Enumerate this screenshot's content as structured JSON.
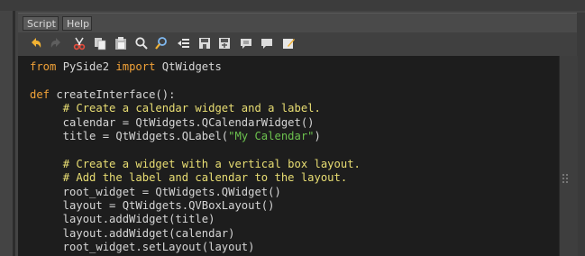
{
  "menu": {
    "items": [
      {
        "label": "Script"
      },
      {
        "label": "Help"
      }
    ]
  },
  "toolbar": {
    "icons": [
      "undo-icon",
      "redo-icon",
      "cut-icon",
      "copy-icon",
      "paste-icon",
      "find-icon",
      "replace-icon",
      "indent-icon",
      "save-icon",
      "save-as-icon",
      "comment-icon",
      "uncomment-icon",
      "edit-icon"
    ]
  },
  "editor": {
    "lines": [
      [
        {
          "t": "kw",
          "v": "from"
        },
        {
          "t": "tx",
          "v": " PySide2 "
        },
        {
          "t": "kw",
          "v": "import"
        },
        {
          "t": "tx",
          "v": " QtWidgets"
        }
      ],
      [],
      [
        {
          "t": "kw",
          "v": "def"
        },
        {
          "t": "tx",
          "v": " createInterface():"
        }
      ],
      [
        {
          "t": "tx",
          "v": "     "
        },
        {
          "t": "cm",
          "v": "# Create a calendar widget and a label."
        }
      ],
      [
        {
          "t": "tx",
          "v": "     calendar = QtWidgets.QCalendarWidget()"
        }
      ],
      [
        {
          "t": "tx",
          "v": "     title = QtWidgets.QLabel("
        },
        {
          "t": "st",
          "v": "\"My Calendar\""
        },
        {
          "t": "tx",
          "v": ")"
        }
      ],
      [],
      [
        {
          "t": "tx",
          "v": "     "
        },
        {
          "t": "cm",
          "v": "# Create a widget with a vertical box layout."
        }
      ],
      [
        {
          "t": "tx",
          "v": "     "
        },
        {
          "t": "cm",
          "v": "# Add the label and calendar to the layout."
        }
      ],
      [
        {
          "t": "tx",
          "v": "     root_widget = QtWidgets.QWidget()"
        }
      ],
      [
        {
          "t": "tx",
          "v": "     layout = QtWidgets.QVBoxLayout()"
        }
      ],
      [
        {
          "t": "tx",
          "v": "     layout.addWidget(title)"
        }
      ],
      [
        {
          "t": "tx",
          "v": "     layout.addWidget(calendar)"
        }
      ],
      [
        {
          "t": "tx",
          "v": "     root_widget.setLayout(layout)"
        }
      ]
    ]
  },
  "colors": {
    "keyword": "#f1a238",
    "comment": "#e9de73",
    "string": "#6cc14e",
    "text": "#d6d6d6",
    "editor_bg": "#1d1d1d"
  }
}
